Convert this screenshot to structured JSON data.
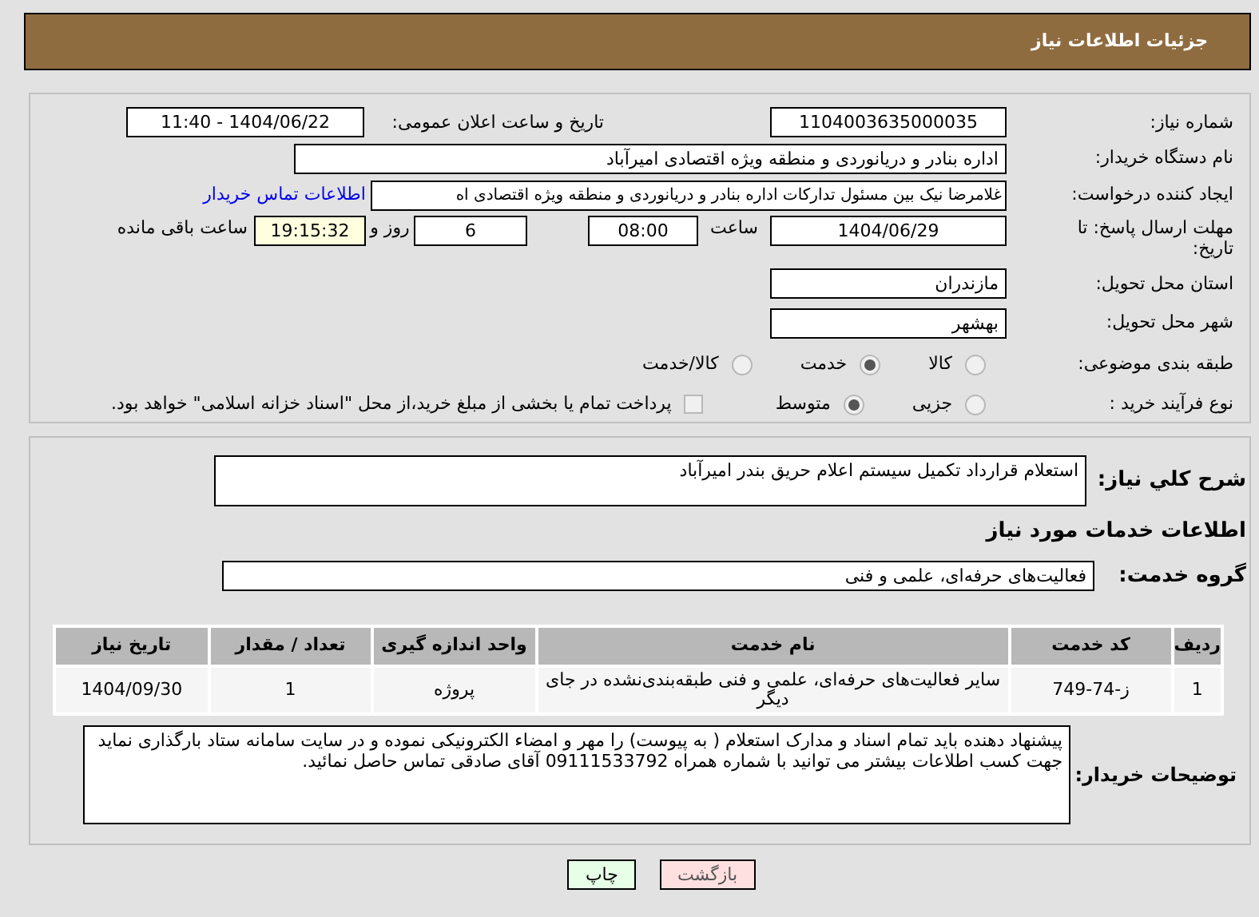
{
  "header": {
    "title": "جزئیات اطلاعات نیاز"
  },
  "need_number": {
    "label": "شماره نیاز:",
    "value": "1104003635000035"
  },
  "announce": {
    "label": "تاریخ و ساعت اعلان عمومی:",
    "value": "1404/06/22 - 11:40"
  },
  "buyer_org": {
    "label": "نام دستگاه خریدار:",
    "value": "اداره بنادر و دریانوردی و منطقه ویژه اقتصادی امیرآباد"
  },
  "requester": {
    "label": "ایجاد کننده درخواست:",
    "value": "غلامرضا نیک بین مسئول تدارکات اداره بنادر و دریانوردی و منطقه ویژه اقتصادی اه",
    "link": "اطلاعات تماس خریدار"
  },
  "deadline": {
    "label": "مهلت ارسال پاسخ: تا تاریخ:",
    "date": "1404/06/29",
    "time_label": "ساعت",
    "time": "08:00",
    "days": "6",
    "days_label": "روز و",
    "remaining": "19:15:32",
    "remaining_label": "ساعت باقی مانده"
  },
  "province": {
    "label": "استان محل تحویل:",
    "value": "مازندران"
  },
  "city": {
    "label": "شهر محل تحویل:",
    "value": "بهشهر"
  },
  "category": {
    "label": "طبقه بندی موضوعی:",
    "options": [
      {
        "label": "کالا",
        "selected": false
      },
      {
        "label": "خدمت",
        "selected": true
      },
      {
        "label": "کالا/خدمت",
        "selected": false
      }
    ]
  },
  "process": {
    "label": "نوع فرآیند خرید :",
    "options": [
      {
        "label": "جزیی",
        "selected": false
      },
      {
        "label": "متوسط",
        "selected": true
      }
    ],
    "treasury": {
      "checked": false,
      "text": "پرداخت تمام یا بخشی از مبلغ خرید،از محل \"اسناد خزانه اسلامی\" خواهد بود."
    }
  },
  "description": {
    "label": "شرح کلي نياز:",
    "value": "استعلام قرارداد تکمیل سیستم اعلام حریق بندر امیرآباد"
  },
  "services_heading": "اطلاعات خدمات مورد نیاز",
  "service_group": {
    "label": "گروه خدمت:",
    "value": "فعالیت‌های حرفه‌ای، علمی و فنی"
  },
  "table": {
    "columns": [
      "ردیف",
      "کد خدمت",
      "نام خدمت",
      "واحد اندازه گیری",
      "تعداد / مقدار",
      "تاریخ نیاز"
    ],
    "rows": [
      [
        "1",
        "ز-74-749",
        "سایر فعالیت‌های حرفه‌ای، علمی و فنی طبقه‌بندی‌نشده در جای دیگر",
        "پروژه",
        "1",
        "1404/09/30"
      ]
    ]
  },
  "buyer_notes": {
    "label": "توضیحات خریدار:",
    "lines": [
      "پیشنهاد دهنده باید تمام اسناد و مدارک استعلام ( به پیوست) را مهر و امضاء الکترونیکی نموده و در سایت سامانه ستاد بارگذاری نماید",
      "جهت کسب اطلاعات بیشتر می توانید با شماره همراه 09111533792 آقای صادقی تماس حاصل نمائید."
    ]
  },
  "buttons": [
    {
      "label": "بازگشت",
      "kind": "back"
    },
    {
      "label": "چاپ",
      "kind": "print"
    }
  ]
}
